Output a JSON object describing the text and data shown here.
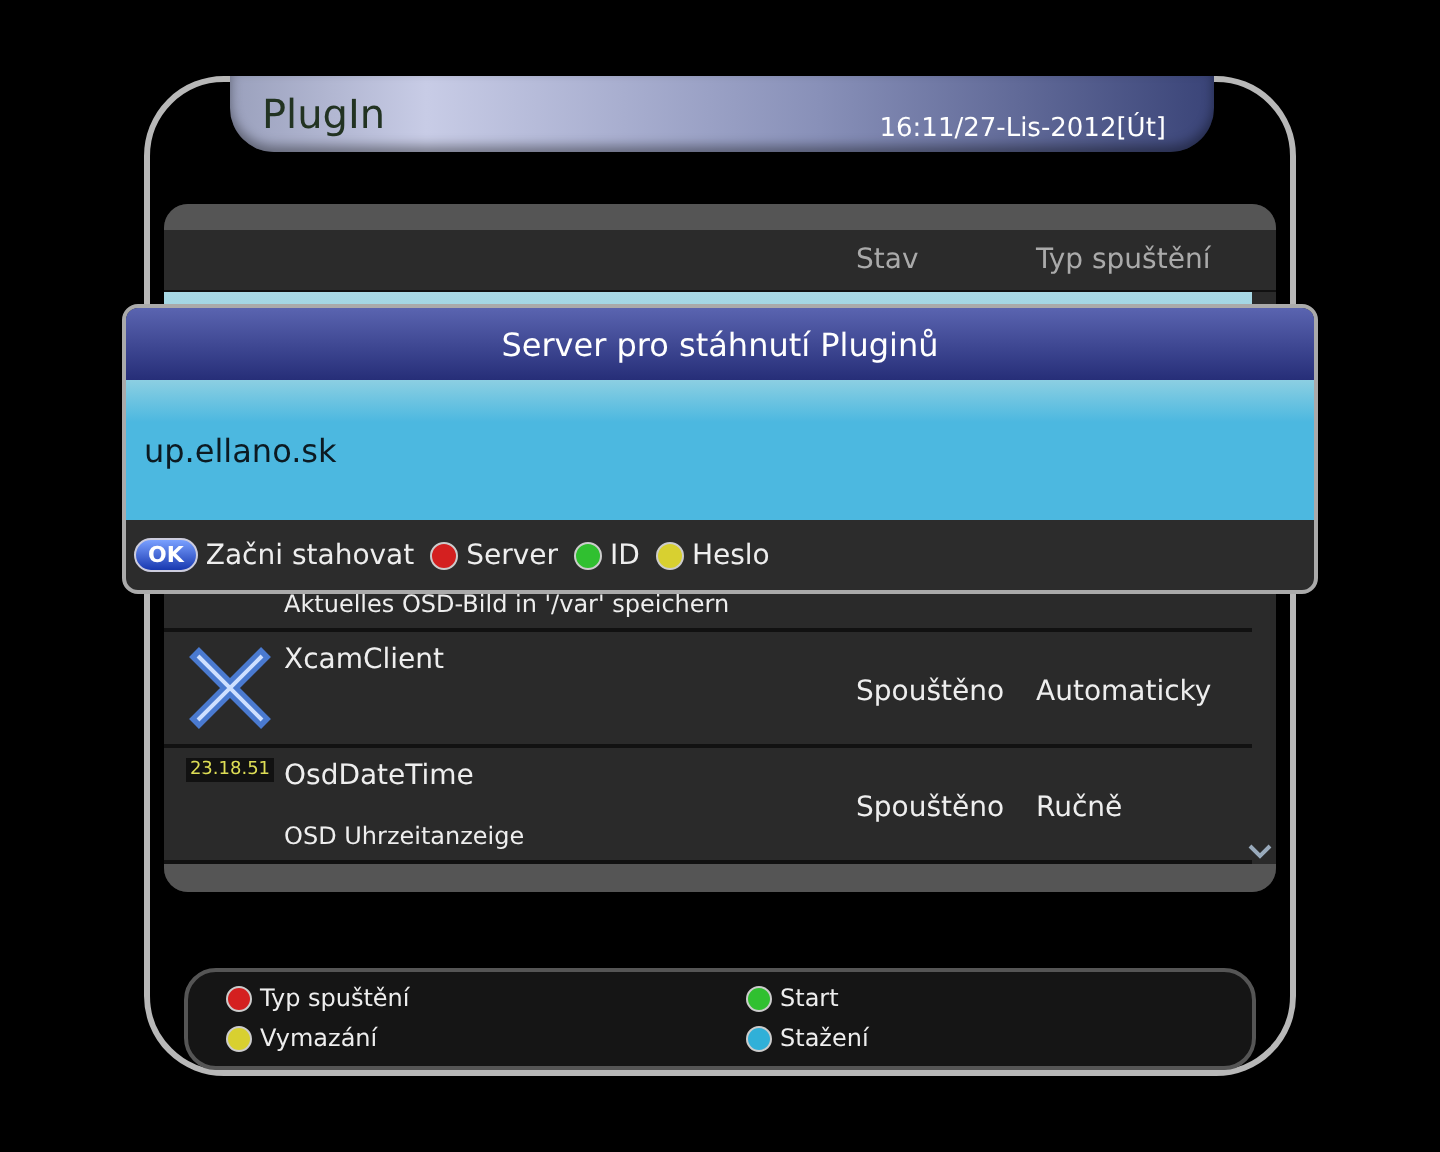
{
  "header": {
    "title": "PlugIn",
    "clock": "16:11/27-Lis-2012[Út]"
  },
  "table": {
    "columns": [
      "Stav",
      "Typ spuštění"
    ],
    "rows": [
      {
        "selected": true
      },
      {
        "selected": false,
        "kind": "camera",
        "description": "Aktuelles OSD-Bild in '/var' speichern"
      },
      {
        "selected": false,
        "kind": "xcam",
        "name": "XcamClient",
        "status": "Spouštěno",
        "start_type": "Automaticky"
      },
      {
        "selected": false,
        "kind": "clock",
        "icon_text": "23.18.51",
        "name": "OsdDateTime",
        "description": "OSD Uhrzeitanzeige",
        "status": "Spouštěno",
        "start_type": "Ručně"
      }
    ]
  },
  "dialog": {
    "title": "Server pro stáhnutí Pluginů",
    "value": "up.ellano.sk",
    "keys": [
      {
        "kind": "ok",
        "key": "OK",
        "label": "Začni stahovat"
      },
      {
        "kind": "dot",
        "color": "#d42020",
        "label": "Server"
      },
      {
        "kind": "dot",
        "color": "#30c030",
        "label": "ID"
      },
      {
        "kind": "dot",
        "color": "#d8d030",
        "label": "Heslo"
      }
    ]
  },
  "legend": [
    {
      "color": "#d42020",
      "label": "Typ spuštění"
    },
    {
      "color": "#30c030",
      "label": "Start"
    },
    {
      "color": "#d8d030",
      "label": "Vymazání"
    },
    {
      "color": "#30b0d8",
      "label": "Stažení"
    }
  ]
}
